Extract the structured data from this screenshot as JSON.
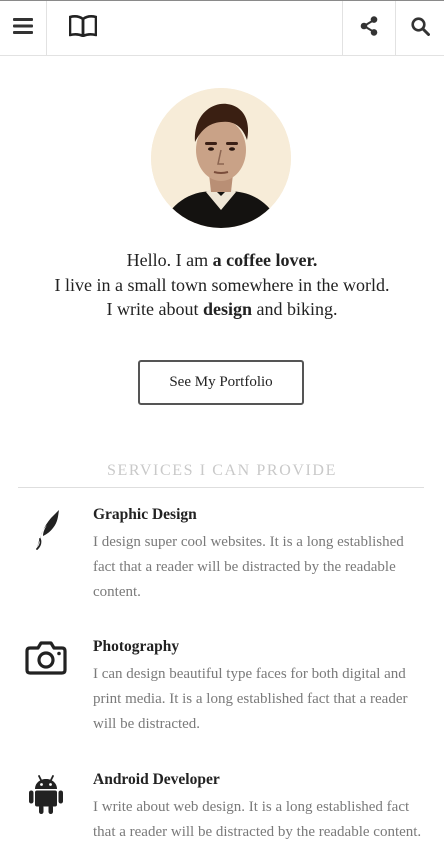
{
  "header": {
    "menu_icon": "hamburger-menu-icon",
    "logo_icon": "open-book-icon",
    "share_icon": "share-icon",
    "search_icon": "search-icon"
  },
  "profile": {
    "avatar": "profile-photo",
    "line1_prefix": "Hello. I am ",
    "line1_bold": "a coffee lover.",
    "line2": "I live in a small town somewhere in the world.",
    "line3_prefix": "I write about ",
    "line3_bold": "design",
    "line3_suffix": " and biking."
  },
  "cta": {
    "label": "See My Portfolio"
  },
  "services": {
    "heading": "SERVICES I CAN PROVIDE",
    "items": [
      {
        "icon": "feather-icon",
        "title": "Graphic Design",
        "desc": "I design super cool websites. It is a long established fact that a reader will be distracted by the readable content."
      },
      {
        "icon": "camera-icon",
        "title": "Photography",
        "desc": "I can design beautiful type faces for both digital and print media. It is a long established fact that a reader will be distracted."
      },
      {
        "icon": "android-icon",
        "title": "Android Developer",
        "desc": "I write about web design. It is a long established fact that a reader will be distracted by the readable content."
      }
    ]
  },
  "colors": {
    "text": "#222222",
    "muted": "#7a7a7a",
    "heading": "#c9c9c9",
    "border": "#e2e2e2"
  }
}
